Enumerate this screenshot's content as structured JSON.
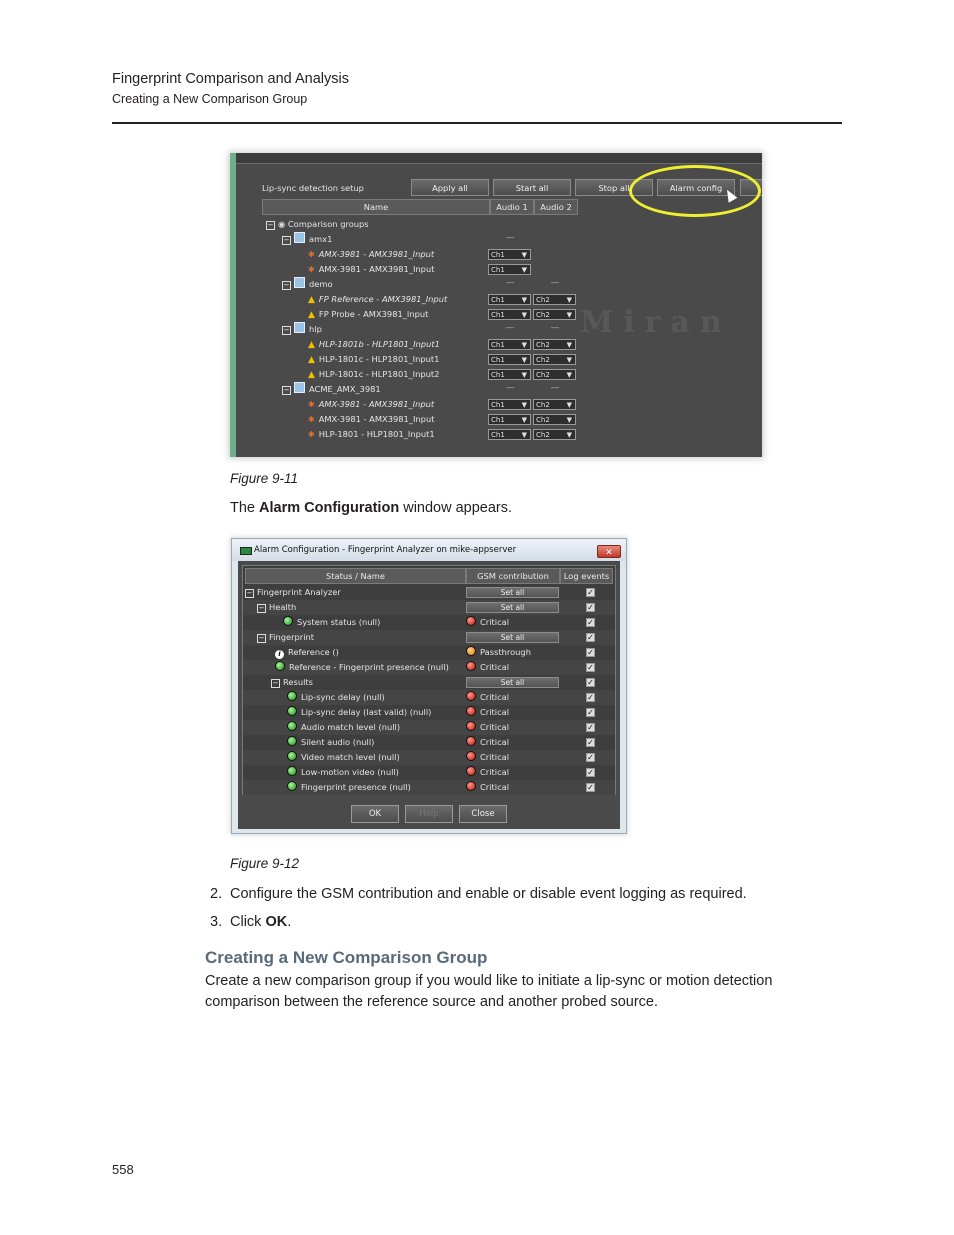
{
  "header": {
    "chapter": "Fingerprint Comparison and Analysis",
    "section": "Creating a New Comparison Group"
  },
  "figure1": {
    "caption": "Figure 9-11",
    "toolbar_label": "Lip-sync detection setup",
    "buttons": [
      "Apply all",
      "Start all",
      "Stop all",
      "Alarm config"
    ],
    "columns": [
      "Name",
      "Audio 1",
      "Audio 2"
    ],
    "root": "Comparison groups",
    "watermark": "Miran",
    "groups": [
      {
        "name": "amx1",
        "items": [
          {
            "label": "AMX-3981 - AMX3981_Input",
            "italic": true,
            "a1": "Ch1",
            "a2": ""
          },
          {
            "label": "AMX-3981 - AMX3981_Input",
            "italic": false,
            "a1": "Ch1",
            "a2": ""
          }
        ]
      },
      {
        "name": "demo",
        "items": [
          {
            "label": "FP Reference - AMX3981_Input",
            "italic": true,
            "a1": "Ch1",
            "a2": "Ch2"
          },
          {
            "label": "FP Probe - AMX3981_Input",
            "italic": false,
            "a1": "Ch1",
            "a2": "Ch2"
          }
        ]
      },
      {
        "name": "hlp",
        "items": [
          {
            "label": "HLP-1801b - HLP1801_Input1",
            "italic": true,
            "a1": "Ch1",
            "a2": "Ch2"
          },
          {
            "label": "HLP-1801c - HLP1801_Input1",
            "italic": false,
            "a1": "Ch1",
            "a2": "Ch2"
          },
          {
            "label": "HLP-1801c - HLP1801_Input2",
            "italic": false,
            "a1": "Ch1",
            "a2": "Ch2"
          }
        ]
      },
      {
        "name": "ACME_AMX_3981",
        "items": [
          {
            "label": "AMX-3981 - AMX3981_Input",
            "italic": true,
            "a1": "Ch1",
            "a2": "Ch2"
          },
          {
            "label": "AMX-3981 - AMX3981_Input",
            "italic": false,
            "a1": "Ch1",
            "a2": "Ch2"
          },
          {
            "label": "HLP-1801 - HLP1801_Input1",
            "italic": false,
            "a1": "Ch1",
            "a2": "Ch2"
          }
        ]
      }
    ],
    "dash": "—"
  },
  "text1": {
    "pre": "The ",
    "bold": "Alarm Configuration",
    "post": " window appears."
  },
  "figure2": {
    "caption": "Figure 9-12",
    "title": "Alarm Configuration - Fingerprint Analyzer on mike-appserver",
    "close": "✕",
    "columns": [
      "Status / Name",
      "GSM contribution",
      "Log events"
    ],
    "set_all": "Set all",
    "rows": [
      {
        "label": "Fingerprint Analyzer",
        "type": "node",
        "status": ""
      },
      {
        "label": "Health",
        "type": "node",
        "status": ""
      },
      {
        "label": "System status (null)",
        "type": "leaf",
        "led": "green",
        "status": "Critical",
        "led2": "red"
      },
      {
        "label": "Fingerprint",
        "type": "node",
        "status": ""
      },
      {
        "label": "Reference ()",
        "type": "leaf",
        "led": "info",
        "status": "Passthrough",
        "led2": "orange"
      },
      {
        "label": "Reference - Fingerprint presence (null)",
        "type": "leaf",
        "led": "green",
        "status": "Critical",
        "led2": "red"
      },
      {
        "label": "Results",
        "type": "node",
        "status": ""
      },
      {
        "label": "Lip-sync delay (null)",
        "type": "leaf",
        "led": "green",
        "status": "Critical",
        "led2": "red"
      },
      {
        "label": "Lip-sync delay (last valid) (null)",
        "type": "leaf",
        "led": "green",
        "status": "Critical",
        "led2": "red"
      },
      {
        "label": "Audio match level (null)",
        "type": "leaf",
        "led": "green",
        "status": "Critical",
        "led2": "red"
      },
      {
        "label": "Silent audio (null)",
        "type": "leaf",
        "led": "green",
        "status": "Critical",
        "led2": "red"
      },
      {
        "label": "Video match level (null)",
        "type": "leaf",
        "led": "green",
        "status": "Critical",
        "led2": "red"
      },
      {
        "label": "Low-motion video (null)",
        "type": "leaf",
        "led": "green",
        "status": "Critical",
        "led2": "red"
      },
      {
        "label": "Fingerprint presence (null)",
        "type": "leaf",
        "led": "green",
        "status": "Critical",
        "led2": "red"
      }
    ],
    "buttons": [
      "OK",
      "Help",
      "Close"
    ]
  },
  "steps": [
    {
      "num": "2.",
      "text": "Configure the GSM contribution and enable or disable event logging as required."
    },
    {
      "num": "3.",
      "pre": "Click ",
      "bold": "OK",
      "post": "."
    }
  ],
  "section": {
    "heading": "Creating a New Comparison Group",
    "paragraph": "Create a new comparison group if you would like to initiate a lip-sync or motion detection comparison between the reference source and another probed source."
  },
  "page_number": "558",
  "colors": {
    "accent_heading": "#5a6a7a",
    "highlight_ring": "#f0ee30"
  }
}
